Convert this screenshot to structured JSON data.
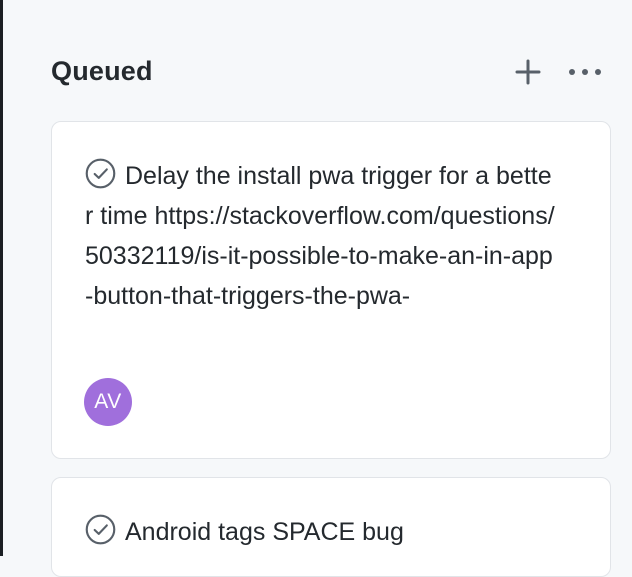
{
  "column": {
    "title": "Queued",
    "add_icon": "plus-icon",
    "more_icon": "kebab-horizontal-icon"
  },
  "cards": [
    {
      "status_icon": "check-circle-icon",
      "title": "Delay the install pwa trigger for a better time",
      "note": "https://stackoverflow.com/questions/50332119/is-it-possible-to-make-an-in-app-button-that-triggers-the-pwa-",
      "assignee_initials": "AV",
      "assignee_color": "#a06fdc"
    },
    {
      "status_icon": "check-circle-icon",
      "title": "Android tags SPACE bug"
    }
  ],
  "colors": {
    "background": "#f6f8fa",
    "card": "#ffffff",
    "border": "#e1e4e8",
    "text": "#24292e",
    "icon": "#586069"
  }
}
